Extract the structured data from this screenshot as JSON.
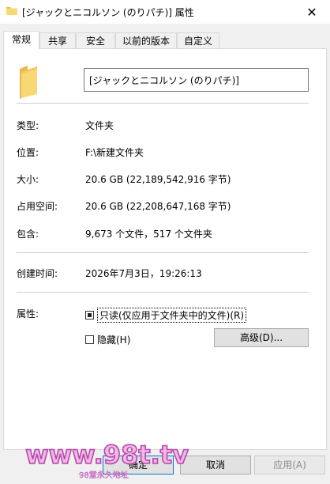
{
  "window": {
    "title": "[ジャックとニコルソン (のりパチ)] 属性",
    "close_glyph": "✕"
  },
  "tabs": [
    {
      "label": "常规",
      "active": true
    },
    {
      "label": "共享",
      "active": false
    },
    {
      "label": "安全",
      "active": false
    },
    {
      "label": "以前的版本",
      "active": false
    },
    {
      "label": "自定义",
      "active": false
    }
  ],
  "folder": {
    "icon": "folder-icon",
    "name": "[ジャックとニコルソン (のりパチ)]"
  },
  "properties": {
    "type": {
      "label": "类型:",
      "value": "文件夹"
    },
    "location": {
      "label": "位置:",
      "value": "F:\\新建文件夹"
    },
    "size": {
      "label": "大小:",
      "value": "20.6 GB (22,189,542,916 字节)"
    },
    "size_on_disk": {
      "label": "占用空间:",
      "value": "20.6 GB (22,208,647,168 字节)"
    },
    "contains": {
      "label": "包含:",
      "value": "9,673 个文件，517 个文件夹"
    },
    "created": {
      "label": "创建时间:",
      "value": "2026年7月3日，19:26:13"
    }
  },
  "attributes": {
    "label": "属性:",
    "readonly": {
      "label": "只读(仅应用于文件夹中的文件)(R)",
      "state": "indeterminate"
    },
    "hidden": {
      "label": "隐藏(H)",
      "state": "unchecked"
    },
    "advanced_button": "高级(D)..."
  },
  "buttons": {
    "ok": "确定",
    "cancel": "取消",
    "apply": "应用(A)"
  },
  "watermark": {
    "text": "www.98t.tv",
    "subtext": "98堂永久地址"
  },
  "colors": {
    "accent": "#0078d7",
    "folder": "#f8d775",
    "folder_dark": "#e8b84a",
    "watermark_fill": "#f4b6e2",
    "watermark_stroke": "#b34ab0"
  }
}
